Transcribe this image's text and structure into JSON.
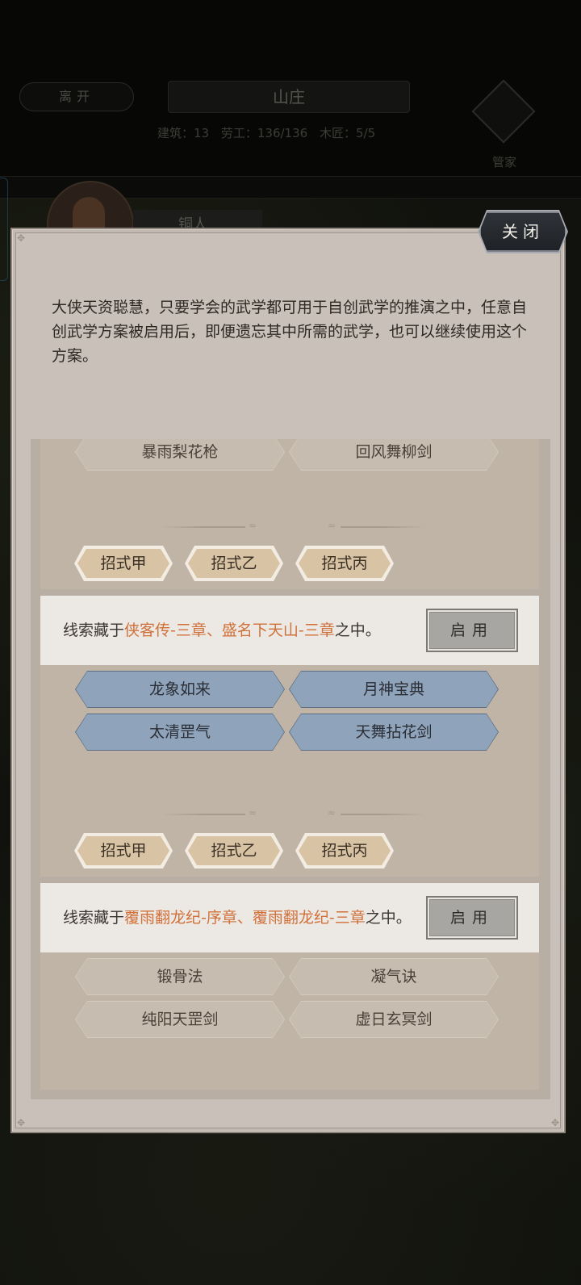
{
  "background": {
    "leave_label": "离开",
    "location_title": "山庄",
    "stats": [
      "建筑：13",
      "劳工：136/136",
      "木匠：5/5"
    ],
    "steward_label": "管家",
    "tab_label": "铜人"
  },
  "modal": {
    "close_label": "关闭",
    "intro": "大侠天资聪慧，只要学会的武学都可用于自创武学的推演之中，任意自创武学方案被启用后，即便遗忘其中所需的武学，也可以继续使用这个方案。",
    "blocks": [
      {
        "skills_top": [
          "暴雨梨花枪",
          "回风舞柳剑"
        ],
        "moves": [
          "招式甲",
          "招式乙",
          "招式丙"
        ],
        "clue": {
          "prefix": "线索藏于",
          "highlight": "侠客传-三章、盛名下天山-三章",
          "suffix": "之中。"
        },
        "enable_label": "启用"
      },
      {
        "skills_top": [
          "龙象如来",
          "月神宝典",
          "太清罡气",
          "天舞拈花剑"
        ],
        "moves": [
          "招式甲",
          "招式乙",
          "招式丙"
        ],
        "clue": {
          "prefix": "线索藏于",
          "highlight": "覆雨翻龙纪-序章、覆雨翻龙纪-三章",
          "suffix": "之中。"
        },
        "enable_label": "启用"
      },
      {
        "skills_top": [
          "锻骨法",
          "凝气诀",
          "纯阳天罡剑",
          "虚日玄冥剑"
        ]
      }
    ]
  }
}
